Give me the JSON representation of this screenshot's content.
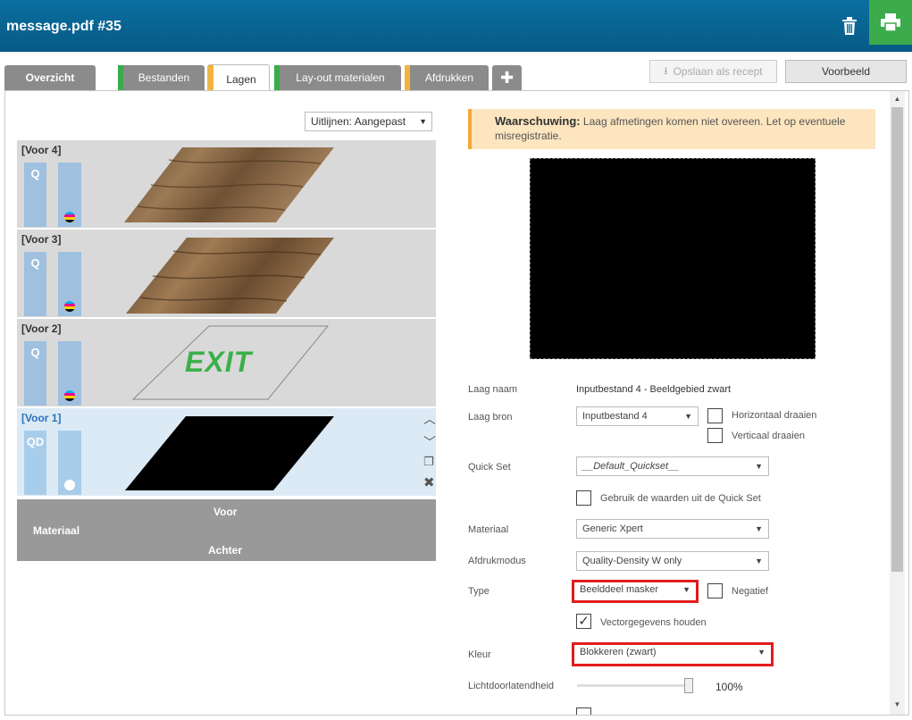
{
  "window": {
    "title": "message.pdf #35"
  },
  "tabs": [
    {
      "label": "Overzicht",
      "stripe": ""
    },
    {
      "label": "Bestanden",
      "stripe": "#3bab4b"
    },
    {
      "label": "Lagen",
      "stripe": "#f2b33d"
    },
    {
      "label": "Lay-out materialen",
      "stripe": "#3bab4b"
    },
    {
      "label": "Afdrukken",
      "stripe": "#f2b33d"
    }
  ],
  "toolbar": {
    "save_recipe": "Opslaan als recept",
    "preview": "Voorbeeld"
  },
  "left": {
    "align_select": "Uitlijnen: Aangepast",
    "layers": [
      {
        "name": "[Voor 4]",
        "mode": "Q",
        "selected": false,
        "content": "wood"
      },
      {
        "name": "[Voor 3]",
        "mode": "Q",
        "selected": false,
        "content": "wood"
      },
      {
        "name": "[Voor 2]",
        "mode": "Q",
        "selected": false,
        "content": "exit",
        "exit_text": "EXIT"
      },
      {
        "name": "[Voor 1]",
        "mode": "QD",
        "selected": true,
        "content": "black"
      }
    ],
    "material": {
      "label": "Materiaal",
      "front": "Voor",
      "back": "Achter"
    }
  },
  "right": {
    "warning": {
      "title": "Waarschuwing:",
      "text": " Laag afmetingen komen niet overeen. Let op eventuele misregistratie."
    },
    "layer_name": {
      "label": "Laag naam",
      "value": "Inputbestand 4 - Beeldgebied zwart"
    },
    "layer_source": {
      "label": "Laag bron",
      "value": "Inputbestand 4",
      "flip_h": "Horizontaal draaien",
      "flip_v": "Verticaal draaien"
    },
    "quick_set": {
      "label": "Quick Set",
      "value": "__Default_Quickset__",
      "use_values": "Gebruik de waarden uit de Quick Set"
    },
    "material": {
      "label": "Materiaal",
      "value": "Generic Xpert"
    },
    "print_mode": {
      "label": "Afdrukmodus",
      "value": "Quality-Density W only"
    },
    "type": {
      "label": "Type",
      "value": "Beelddeel masker",
      "negative": "Negatief",
      "keep_vector": "Vectorgegevens houden",
      "keep_vector_checked": true
    },
    "color": {
      "label": "Kleur",
      "value": "Blokkeren (zwart)"
    },
    "opacity": {
      "label": "Lichtdoorlatendheid",
      "value": "100%",
      "level": 1.0
    }
  },
  "colors": {
    "titlebar": "#0a6fa0",
    "print_button": "#3bab4b",
    "warning_bg": "#fde5bf",
    "highlight": "#e11d1d"
  }
}
